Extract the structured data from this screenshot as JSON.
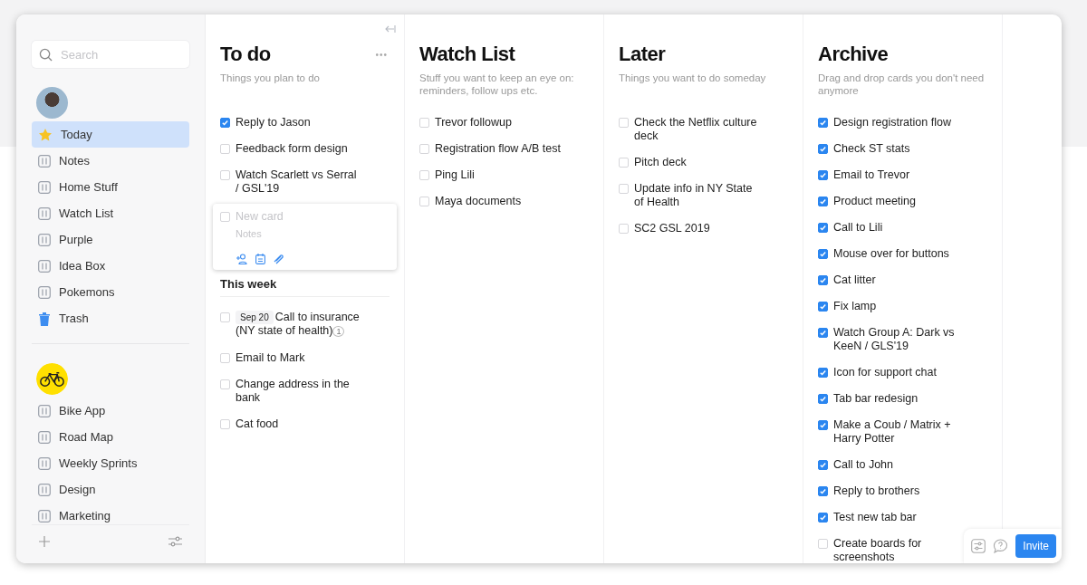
{
  "sidebar": {
    "search": {
      "placeholder": "Search"
    },
    "groups": [
      {
        "items": [
          {
            "label": "Today",
            "kind": "star",
            "selected": true
          },
          {
            "label": "Notes",
            "kind": "board",
            "selected": false
          },
          {
            "label": "Home Stuff",
            "kind": "board",
            "selected": false
          },
          {
            "label": "Watch List",
            "kind": "board",
            "selected": false
          },
          {
            "label": "Purple",
            "kind": "board",
            "selected": false
          },
          {
            "label": "Idea Box",
            "kind": "board",
            "selected": false
          },
          {
            "label": "Pokemons",
            "kind": "board",
            "selected": false
          },
          {
            "label": "Trash",
            "kind": "trash",
            "selected": false
          }
        ]
      },
      {
        "items": [
          {
            "label": "Bike App",
            "kind": "board",
            "selected": false
          },
          {
            "label": "Road Map",
            "kind": "board",
            "selected": false
          },
          {
            "label": "Weekly Sprints",
            "kind": "board",
            "selected": false
          },
          {
            "label": "Design",
            "kind": "board",
            "selected": false
          },
          {
            "label": "Marketing",
            "kind": "board",
            "selected": false
          }
        ]
      }
    ]
  },
  "columns": [
    {
      "title": "To do",
      "subtitle": "Things you plan to do",
      "menu": "•••",
      "cards": [
        {
          "text": "Reply to Jason",
          "checked": true
        },
        {
          "text": "Feedback form design",
          "checked": false
        },
        {
          "text": "Watch Scarlett vs Serral / GSL'19",
          "checked": false
        }
      ],
      "new_card": {
        "checked": false,
        "title_placeholder": "New card",
        "notes_placeholder": "Notes"
      },
      "sections": [
        {
          "title": "This week",
          "cards": [
            {
              "text": "Call to insurance (NY state of health)",
              "checked": false,
              "date": "Sep 20",
              "comments": "1"
            },
            {
              "text": "Email to Mark",
              "checked": false
            },
            {
              "text": "Change address in the bank",
              "checked": false
            },
            {
              "text": "Cat food",
              "checked": false
            }
          ]
        }
      ]
    },
    {
      "title": "Watch List",
      "subtitle": "Stuff you want to keep an eye on: reminders, follow ups etc.",
      "cards": [
        {
          "text": "Trevor followup",
          "checked": false
        },
        {
          "text": "Registration flow A/B test",
          "checked": false
        },
        {
          "text": "Ping Lili",
          "checked": false
        },
        {
          "text": "Maya documents",
          "checked": false
        }
      ]
    },
    {
      "title": "Later",
      "subtitle": "Things you want to do someday",
      "cards": [
        {
          "text": "Check the Netflix culture deck",
          "checked": false
        },
        {
          "text": "Pitch deck",
          "checked": false
        },
        {
          "text": "Update info in NY State of Health",
          "checked": false
        },
        {
          "text": "SC2 GSL 2019",
          "checked": false
        }
      ]
    },
    {
      "title": "Archive",
      "subtitle": "Drag and drop cards you don't need anymore",
      "cards": [
        {
          "text": "Design registration flow",
          "checked": true
        },
        {
          "text": "Check ST stats",
          "checked": true
        },
        {
          "text": "Email to Trevor",
          "checked": true
        },
        {
          "text": "Product meeting",
          "checked": true
        },
        {
          "text": "Call to Lili",
          "checked": true
        },
        {
          "text": "Mouse over for buttons",
          "checked": true
        },
        {
          "text": "Cat litter",
          "checked": true
        },
        {
          "text": "Fix lamp",
          "checked": true
        },
        {
          "text": "Watch Group A: Dark vs KeeN / GLS'19",
          "checked": true
        },
        {
          "text": "Icon for support chat",
          "checked": true
        },
        {
          "text": "Tab bar redesign",
          "checked": true
        },
        {
          "text": "Make a Coub / Matrix + Harry Potter",
          "checked": true
        },
        {
          "text": "Call to John",
          "checked": true
        },
        {
          "text": "Reply to brothers",
          "checked": true
        },
        {
          "text": "Test new tab bar",
          "checked": true
        },
        {
          "text": "Create boards for screenshots",
          "checked": false
        }
      ]
    }
  ],
  "invite_button": "Invite"
}
